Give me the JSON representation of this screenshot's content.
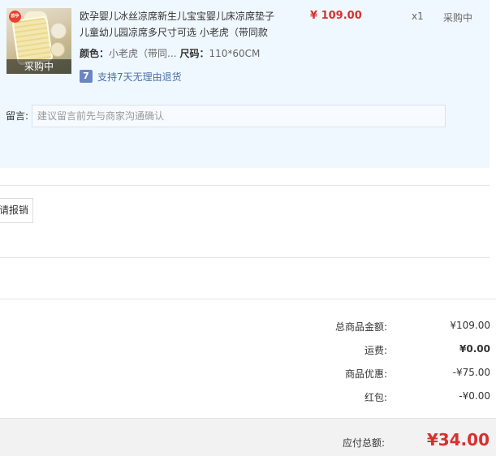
{
  "item": {
    "title": "欧孕婴儿冰丝凉席新生儿宝宝婴儿床凉席垫子儿童幼儿园凉席多尺寸可选 小老虎（带同款",
    "thumb_tag": "采购中",
    "thumb_logo": "欧孕",
    "sku_color_label": "颜色：",
    "sku_color_value": "小老虎（带同...",
    "sku_size_label": "尺码：",
    "sku_size_value": "110*60CM",
    "service_icon": "7",
    "service_text": "支持7天无理由退货",
    "price": "¥ 109.00",
    "quantity": "x1",
    "status": "采购中"
  },
  "message": {
    "label": "留言:",
    "placeholder": "建议留言前先与商家沟通确认"
  },
  "invoice": {
    "button_label": "申请报销"
  },
  "summary": {
    "rows": [
      {
        "label": "总商品金额:",
        "value": "¥109.00"
      },
      {
        "label": "运费:",
        "value": "¥0.00"
      },
      {
        "label": "商品优惠:",
        "value": "-¥75.00"
      },
      {
        "label": "红包:",
        "value": "-¥0.00"
      }
    ],
    "total_label": "应付总额:",
    "total_value": "¥34.00"
  },
  "colors": {
    "accent_red": "#d8302f",
    "panel_bg": "#f0f8ff",
    "service_blue": "#4a6fa5"
  }
}
